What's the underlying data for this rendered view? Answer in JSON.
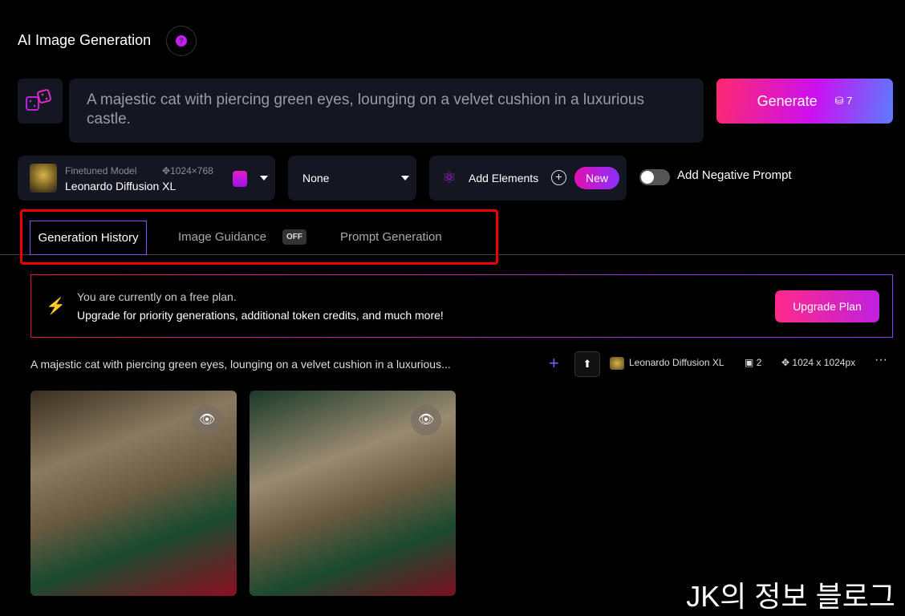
{
  "header": {
    "title": "AI Image Generation"
  },
  "prompt": {
    "text": "A majestic cat with piercing green eyes, lounging on a velvet cushion in a luxurious castle."
  },
  "generate": {
    "label": "Generate",
    "cost": "7"
  },
  "model": {
    "caption": "Finetuned Model",
    "dimensions": "1024×768",
    "name": "Leonardo Diffusion XL"
  },
  "style": {
    "selected": "None"
  },
  "elements": {
    "label": "Add Elements",
    "badge": "New"
  },
  "negative": {
    "label": "Add Negative Prompt",
    "enabled": false
  },
  "tabs": [
    {
      "label": "Generation History",
      "active": true
    },
    {
      "label": "Image Guidance",
      "badge": "OFF"
    },
    {
      "label": "Prompt Generation"
    }
  ],
  "banner": {
    "line1": "You are currently on a free plan.",
    "line2": "Upgrade for priority generations, additional token credits, and much more!",
    "button": "Upgrade Plan"
  },
  "history": {
    "prompt": "A majestic cat with piercing green eyes, lounging on a velvet cushion in a luxurious...",
    "model": "Leonardo Diffusion XL",
    "count": "2",
    "size": "1024 x 1024px"
  },
  "watermark": "JK의 정보 블로그",
  "colors": {
    "accent": "#c51cf0",
    "highlight": "#e00000"
  }
}
